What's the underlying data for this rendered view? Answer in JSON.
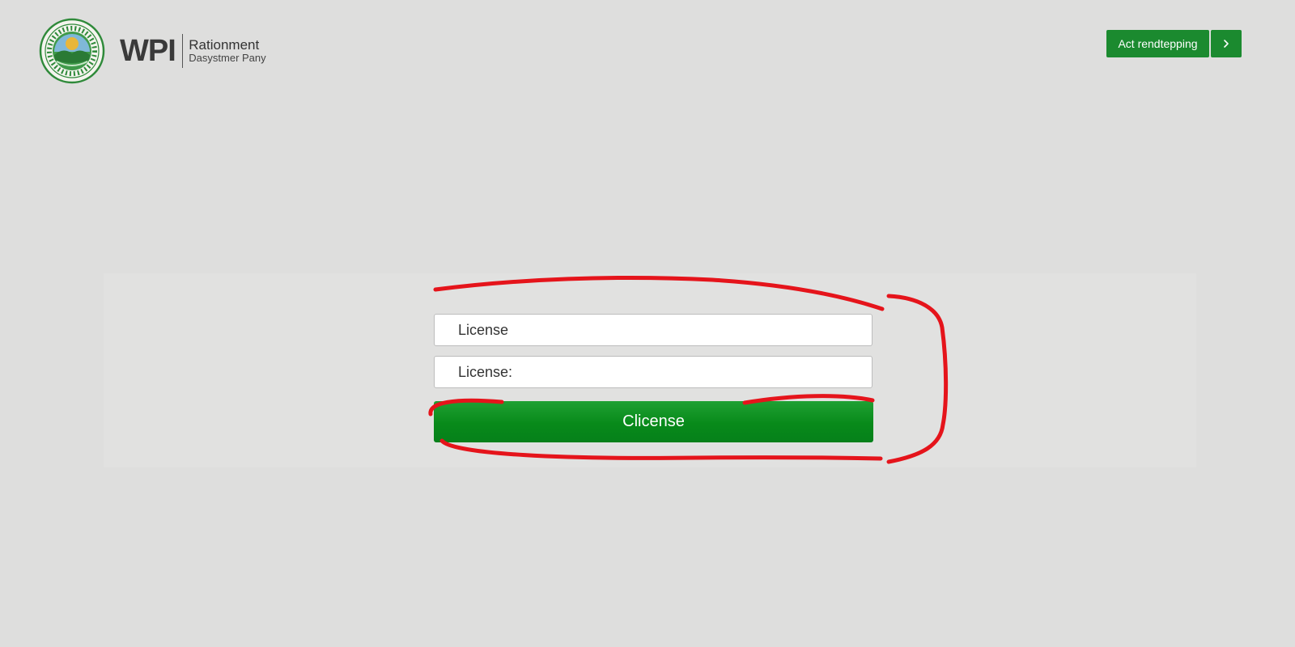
{
  "header": {
    "seal_icon": "seal-logo-icon",
    "brand_abbr": "WPI",
    "brand_name": "Rationment",
    "brand_sub": "Dasystmer Pany",
    "action_label": "Act rendtepping",
    "action_icon": "chevron-right-icon"
  },
  "form": {
    "field_1_text": "License",
    "field_2_text": "License:",
    "submit_label": "Clicense"
  },
  "colors": {
    "accent": "#1b8a2f",
    "annotation": "#e5141b",
    "background": "#dededd"
  }
}
